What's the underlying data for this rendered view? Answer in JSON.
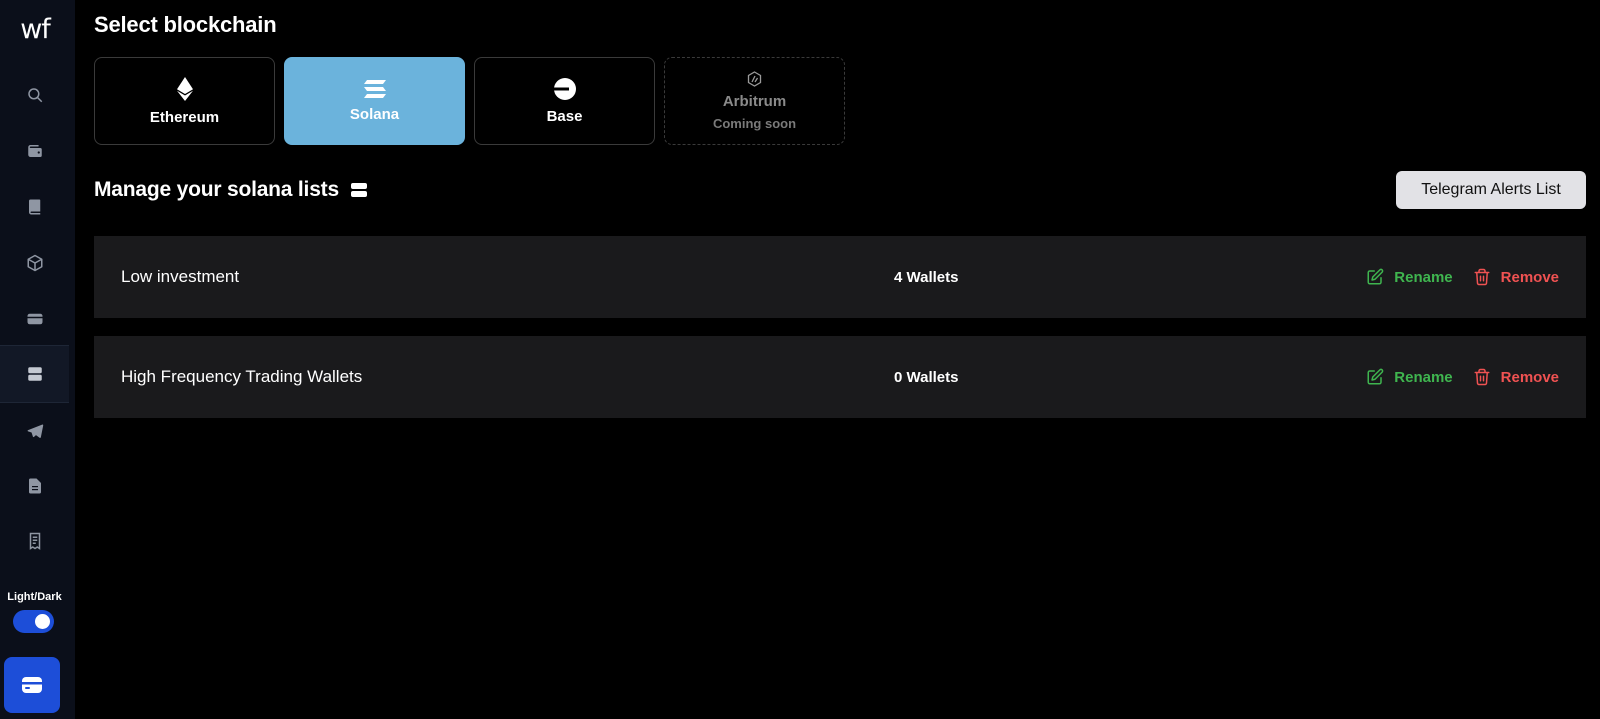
{
  "app": {
    "logo_text": "wf"
  },
  "sidebar": {
    "items": [
      {
        "name": "search",
        "icon": "search-icon"
      },
      {
        "name": "wallet",
        "icon": "wallet-icon"
      },
      {
        "name": "book",
        "icon": "book-icon"
      },
      {
        "name": "cube",
        "icon": "cube-icon"
      },
      {
        "name": "card",
        "icon": "card-icon"
      },
      {
        "name": "lists",
        "icon": "server-icon",
        "active": true
      },
      {
        "name": "telegram",
        "icon": "telegram-icon"
      },
      {
        "name": "document",
        "icon": "document-icon"
      },
      {
        "name": "receipt",
        "icon": "receipt-icon"
      }
    ],
    "theme_label": "Light/Dark",
    "theme_toggle_on": true,
    "bottom_button_icon": "wallet-icon"
  },
  "blockchain": {
    "heading": "Select blockchain",
    "chains": [
      {
        "label": "Ethereum",
        "icon": "ethereum-icon",
        "selected": false
      },
      {
        "label": "Solana",
        "icon": "solana-icon",
        "selected": true
      },
      {
        "label": "Base",
        "icon": "base-icon",
        "selected": false
      },
      {
        "label": "Arbitrum",
        "icon": "arbitrum-icon",
        "sublabel": "Coming soon",
        "disabled": true
      }
    ]
  },
  "lists": {
    "heading": "Manage your solana lists",
    "telegram_button": "Telegram Alerts List",
    "rows": [
      {
        "name": "Low investment",
        "count": "4 Wallets",
        "rename": "Rename",
        "remove": "Remove"
      },
      {
        "name": "High Frequency Trading Wallets",
        "count": "0 Wallets",
        "rename": "Rename",
        "remove": "Remove"
      }
    ]
  },
  "colors": {
    "accent_blue": "#1d4ed8",
    "selected_chain": "#6bb3dc",
    "rename_green": "#3fb54f",
    "remove_red": "#f05252",
    "row_bg": "#1a1a1c"
  }
}
